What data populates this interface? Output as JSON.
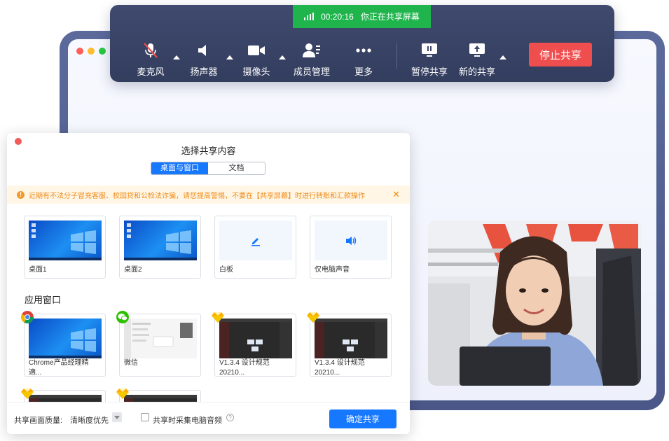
{
  "toolbar": {
    "timer": "00:20:16",
    "status_text": "你正在共享屏幕",
    "items": [
      {
        "label": "麦克风",
        "icon": "mic-muted-icon"
      },
      {
        "label": "扬声器",
        "icon": "speaker-icon"
      },
      {
        "label": "摄像头",
        "icon": "camera-icon"
      },
      {
        "label": "成员管理",
        "icon": "members-icon"
      },
      {
        "label": "更多",
        "icon": "more-icon"
      },
      {
        "label": "暂停共享",
        "icon": "pause-share-icon"
      },
      {
        "label": "新的共享",
        "icon": "new-share-icon"
      }
    ],
    "stop_label": "停止共享"
  },
  "dialog": {
    "title": "选择共享内容",
    "tabs": [
      "桌面与窗口",
      "文档"
    ],
    "active_tab": "桌面与窗口",
    "warning": "近期有不法分子冒充客服、校园贷和公检法诈骗，请您提高警惕，不要在【共享屏幕】时进行转账和汇款操作",
    "screens": [
      {
        "name": "桌面1"
      },
      {
        "name": "桌面2"
      },
      {
        "name": "白板",
        "icon": "pencil-icon"
      },
      {
        "name": "仅电脑声音",
        "icon": "volume-icon"
      }
    ],
    "app_section_title": "应用窗口",
    "apps": [
      {
        "line1": "Chrome产品经理精",
        "line2": "適...",
        "icon": "chrome-icon"
      },
      {
        "line1": "微信",
        "line2": "",
        "icon": "wechat-icon"
      },
      {
        "line1": "V1.3.4 设计规范",
        "line2": "20210...",
        "icon": "sketch-icon"
      },
      {
        "line1": "V1.3.4 设计规范",
        "line2": "20210...",
        "icon": "sketch-icon"
      }
    ],
    "footer": {
      "quality_label": "共享画面质量:",
      "quality_value": "清晰度优先",
      "audio_label": "共享时采集电脑音频",
      "audio_checked": false,
      "help": "?",
      "confirm": "确定共享"
    }
  },
  "colors": {
    "accent": "#1677ff",
    "stop": "#ef4e4e",
    "recording": "#1fb54c",
    "toolbar": "#3a4466",
    "warning": "#f08c1a"
  }
}
